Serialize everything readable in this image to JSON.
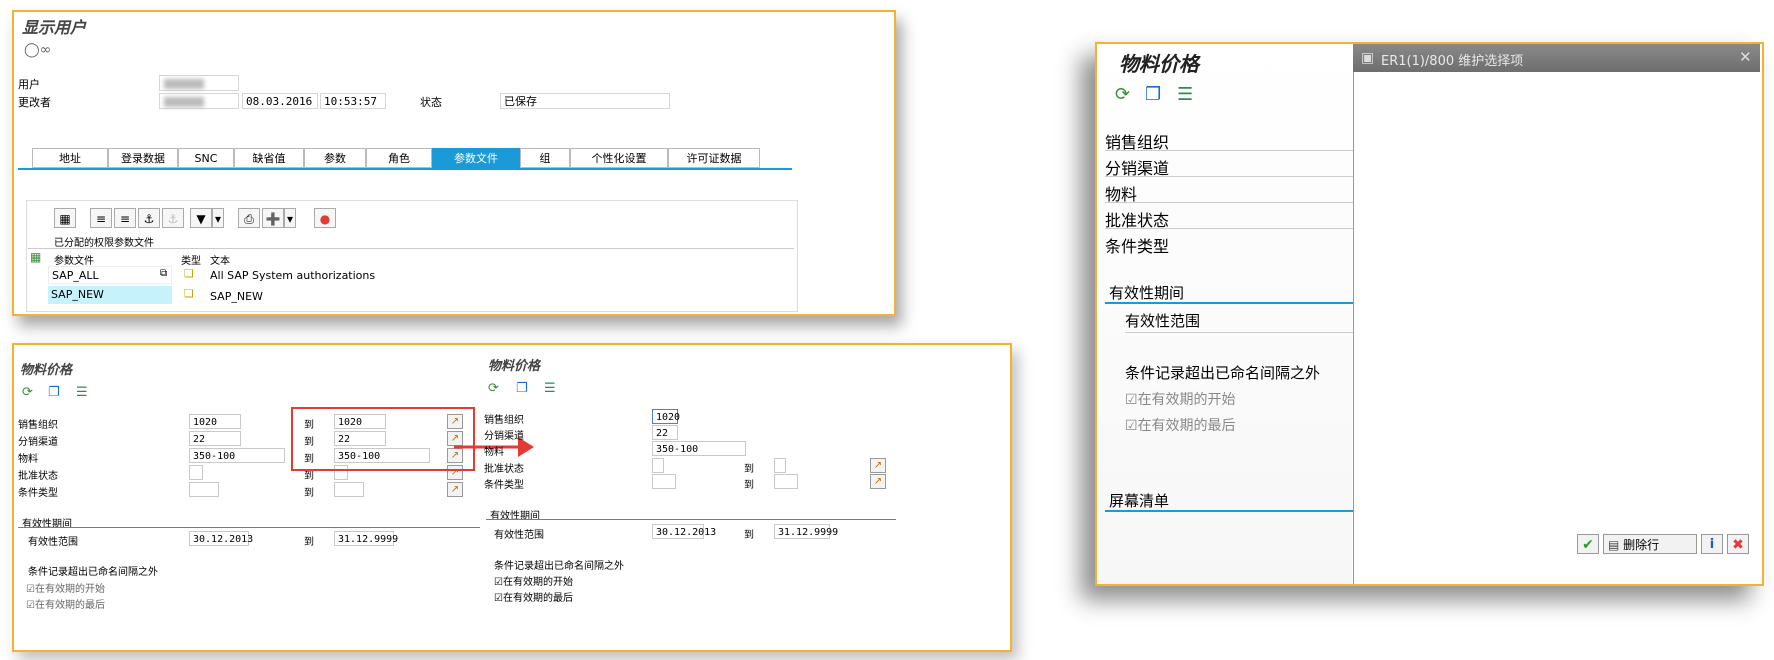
{
  "display_user": {
    "title": "显示用户",
    "glasses_icon": "glasses-icon",
    "user_label": "用户",
    "changed_by_label": "更改者",
    "date": "08.03.2016",
    "time": "10:53:57",
    "status_label": "状态",
    "status_value": "已保存",
    "tabs": [
      "地址",
      "登录数据",
      "SNC",
      "缺省值",
      "参数",
      "角色",
      "参数文件",
      "组",
      "个性化设置",
      "许可证数据"
    ],
    "active_tab": "参数文件",
    "toolbar_icons": [
      "details-icon",
      "sort-asc-icon",
      "sort-desc-icon",
      "find-icon",
      "find-next-icon",
      "filter-icon",
      "print-icon",
      "export-icon",
      "layout-icon"
    ],
    "section_title": "已分配的权限参数文件",
    "table": {
      "headers": [
        "参数文件",
        "类型",
        "文本"
      ],
      "rows": [
        {
          "profile": "SAP_ALL",
          "text": "All SAP System authorizations"
        },
        {
          "profile": "SAP_NEW",
          "text": "SAP_NEW"
        }
      ]
    }
  },
  "material_price_left": {
    "title": "物料价格",
    "rows": [
      {
        "label": "销售组织",
        "from": "1020",
        "to_label": "到",
        "to": "1020"
      },
      {
        "label": "分销渠道",
        "from": "22",
        "to_label": "到",
        "to": "22"
      },
      {
        "label": "物料",
        "from": "350-100",
        "to_label": "到",
        "to": "350-100"
      },
      {
        "label": "批准状态",
        "from": "",
        "to_label": "到",
        "to": ""
      },
      {
        "label": "条件类型",
        "from": "",
        "to_label": "到",
        "to": ""
      }
    ],
    "validity_section": "有效性期间",
    "validity_label": "有效性范围",
    "validity_from": "30.12.2013",
    "validity_to_label": "到",
    "validity_to": "31.12.9999",
    "cond_heading": "条件记录超出已命名间隔之外",
    "cb_start": "在有效期的开始",
    "cb_end": "在有效期的最后"
  },
  "material_price_right": {
    "title": "物料价格",
    "rows": [
      {
        "label": "销售组织",
        "from": "1020"
      },
      {
        "label": "分销渠道",
        "from": "22"
      },
      {
        "label": "物料",
        "from": "350-100"
      },
      {
        "label": "批准状态",
        "from": "",
        "to_label": "到"
      },
      {
        "label": "条件类型",
        "from": "",
        "to_label": "到"
      }
    ],
    "validity_section": "有效性期间",
    "validity_label": "有效性范围",
    "validity_from": "30.12.2013",
    "validity_to_label": "到",
    "validity_to": "31.12.9999",
    "cond_heading": "条件记录超出已命名间隔之外",
    "cb_start": "在有效期的开始",
    "cb_end": "在有效期的最后"
  },
  "zoom_panel": {
    "title": "物料价格",
    "labels": [
      "销售组织",
      "分销渠道",
      "物料",
      "批准状态",
      "条件类型"
    ],
    "validity_section": "有效性期间",
    "validity_label": "有效性范围",
    "cond_heading": "条件记录超出已命名间隔之外",
    "cb_start": "在有效期的开始",
    "cb_end": "在有效期的最后",
    "screen_list": "屏幕清单",
    "dialog_title": "ER1(1)/800 维护选择项",
    "delete_row": "删除行"
  },
  "colors": {
    "frame": "#f2b233",
    "accent": "#1a9bd7",
    "highlight": "#e53935"
  }
}
